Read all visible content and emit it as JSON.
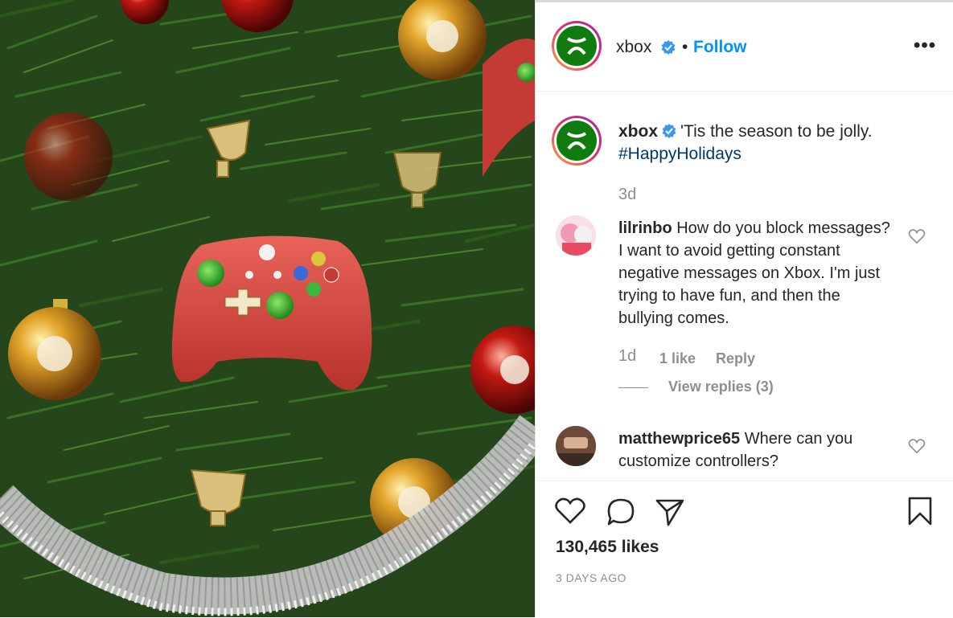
{
  "post": {
    "account": "xbox",
    "follow_label": "Follow",
    "separator": "•",
    "more_label": "•••",
    "caption_text": "'Tis the season to be jolly.",
    "caption_hashtag": "#HappyHolidays",
    "caption_age": "3d",
    "likes": "130,465 likes",
    "posted": "3 DAYS AGO"
  },
  "comments": [
    {
      "user": "lilrinbo",
      "text": "How do you block messages? I want to avoid getting constant negative messages on Xbox. I'm just trying to have fun, and then the bullying comes.",
      "age": "1d",
      "likes": "1 like",
      "reply": "Reply",
      "view_replies": "View replies (3)"
    },
    {
      "user": "matthewprice65",
      "text": "Where can you customize controllers?"
    }
  ],
  "icons": {
    "like": "heart-icon",
    "comment": "comment-icon",
    "share": "share-icon",
    "save": "bookmark-icon",
    "verified": "verified-badge-icon",
    "more": "more-options-icon"
  },
  "colors": {
    "accent": "#0095f6",
    "hashtag": "#00376b",
    "xbox_green": "#107c10",
    "controller_red": "#d9443f"
  }
}
